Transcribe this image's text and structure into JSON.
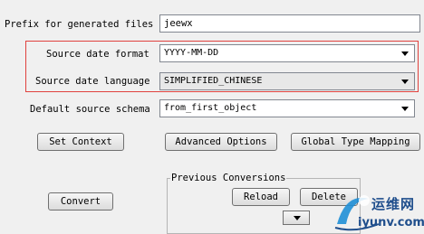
{
  "form": {
    "prefix": {
      "label": "Prefix for generated files",
      "value": "jeewx"
    },
    "date_format": {
      "label": "Source date format",
      "value": "YYYY-MM-DD"
    },
    "date_language": {
      "label": "Source date language",
      "value": "SIMPLIFIED_CHINESE"
    },
    "schema": {
      "label": "Default source schema",
      "value": "from_first_object"
    }
  },
  "buttons": {
    "set_context": "Set Context",
    "advanced_options": "Advanced Options",
    "global_type_mapping": "Global Type Mapping",
    "convert": "Convert",
    "reload": "Reload",
    "delete": "Delete"
  },
  "previous_conversions": {
    "title": "Previous Conversions"
  },
  "watermark": {
    "line1": "运维网",
    "line2": "iyunv.com"
  },
  "colors": {
    "highlight_border": "#e0423e",
    "window_bg": "#f0f0f0",
    "watermark": "#1f4e8c"
  },
  "icons": [
    "dropdown-arrow-icon",
    "watermark-logo-icon"
  ]
}
